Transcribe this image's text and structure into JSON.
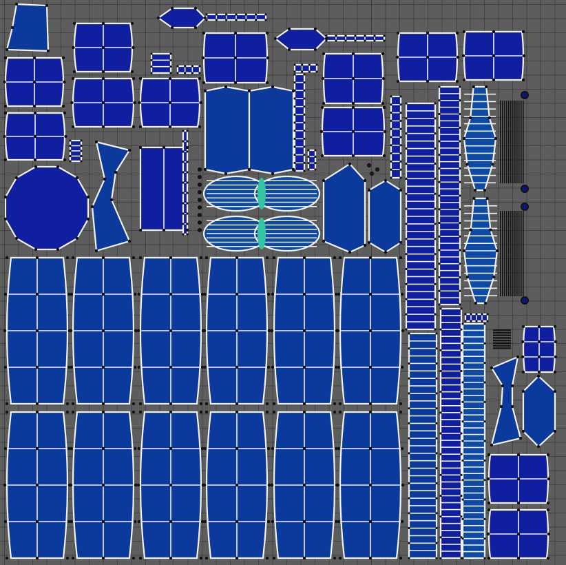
{
  "editor": {
    "view": "UV Editor",
    "grid_visible": true,
    "background_color": "#5d5d5d",
    "grid_color": "#4a4a4a"
  },
  "uv_map": {
    "fill_color": "#101ea0",
    "alt_fill_color": "#0b3a9c",
    "edge_color": "#f2f2f2",
    "vertex_color": "#111111",
    "overlap_highlight_color": "#33c6a0"
  }
}
